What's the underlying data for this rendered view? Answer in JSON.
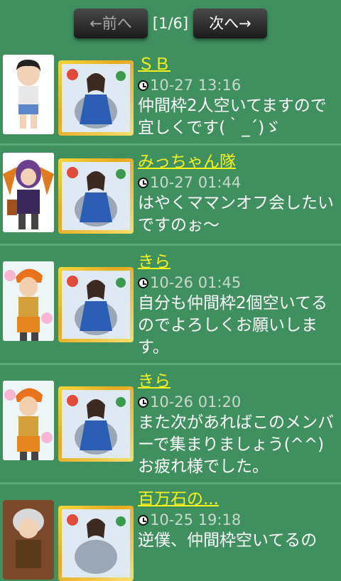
{
  "pager": {
    "prev_label": "←前へ",
    "indicator": "[1/6]",
    "next_label": "次へ→"
  },
  "posts": [
    {
      "name": "ＳＢ",
      "time": "10-27 13:16",
      "message": "仲間枠2人空いてますので宜しくです(｀_´)ゞ"
    },
    {
      "name": "みっちゃん隊",
      "time": "10-27 01:44",
      "message": "はやくママンオフ会したいですのぉ～"
    },
    {
      "name": "きら",
      "time": "10-26 01:45",
      "message": "自分も仲間枠2個空いてるのでよろしくお願いします。"
    },
    {
      "name": "きら",
      "time": "10-26 01:20",
      "message": "また次があればこのメンバーで集まりましょう(^^)お疲れ様でした。"
    },
    {
      "name": "百万石の...",
      "time": "10-25 19:18",
      "message": "逆僕、仲間枠空いてるの"
    }
  ],
  "colors": {
    "background": "#3f8f5f",
    "name": "#f7f21c",
    "time": "#c9d9cf"
  }
}
